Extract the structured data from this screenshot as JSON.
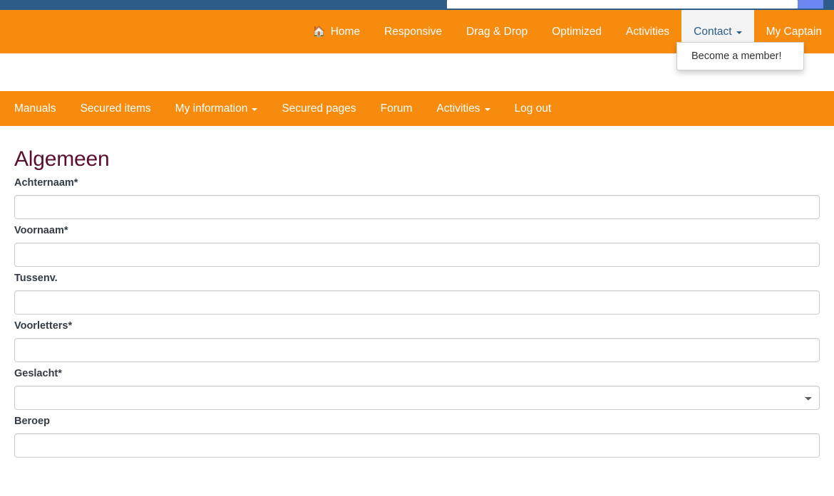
{
  "browser": {
    "url_value": "",
    "action_label": ""
  },
  "topnav": {
    "items": [
      {
        "label": "Home",
        "icon": "home-icon",
        "has_caret": false,
        "active": false
      },
      {
        "label": "Responsive",
        "icon": "",
        "has_caret": false,
        "active": false
      },
      {
        "label": "Drag & Drop",
        "icon": "",
        "has_caret": false,
        "active": false
      },
      {
        "label": "Optimized",
        "icon": "",
        "has_caret": false,
        "active": false
      },
      {
        "label": "Activities",
        "icon": "",
        "has_caret": false,
        "active": false
      },
      {
        "label": "Contact",
        "icon": "",
        "has_caret": true,
        "active": true
      },
      {
        "label": "My Captain",
        "icon": "",
        "has_caret": false,
        "active": false
      }
    ],
    "dropdown": {
      "items": [
        {
          "label": "Become a member!"
        }
      ]
    }
  },
  "subnav": {
    "items": [
      {
        "label": "Manuals",
        "has_caret": false
      },
      {
        "label": "Secured items",
        "has_caret": false
      },
      {
        "label": "My information",
        "has_caret": true
      },
      {
        "label": "Secured pages",
        "has_caret": false
      },
      {
        "label": "Forum",
        "has_caret": false
      },
      {
        "label": "Activities",
        "has_caret": true
      },
      {
        "label": "Log out",
        "has_caret": false
      }
    ]
  },
  "main": {
    "title": "Algemeen",
    "fields": [
      {
        "label": "Achternaam*",
        "type": "text",
        "value": "",
        "placeholder": ""
      },
      {
        "label": "Voornaam*",
        "type": "text",
        "value": "",
        "placeholder": ""
      },
      {
        "label": "Tussenv.",
        "type": "text",
        "value": "",
        "placeholder": ""
      },
      {
        "label": "Voorletters*",
        "type": "text",
        "value": "",
        "placeholder": ""
      },
      {
        "label": "Geslacht*",
        "type": "select",
        "value": "",
        "placeholder": "",
        "options": [
          ""
        ]
      },
      {
        "label": "Beroep",
        "type": "text",
        "value": "",
        "placeholder": ""
      }
    ]
  },
  "colors": {
    "brand_orange": "#f68b0e",
    "title_maroon": "#5a0f2e",
    "active_tab_bg": "#f3f3f3",
    "active_tab_text": "#2e5d8a",
    "browser_chrome": "#2d5c88",
    "browser_button": "#6b88f0",
    "label_text": "#333b44",
    "input_border": "#cccccc"
  }
}
